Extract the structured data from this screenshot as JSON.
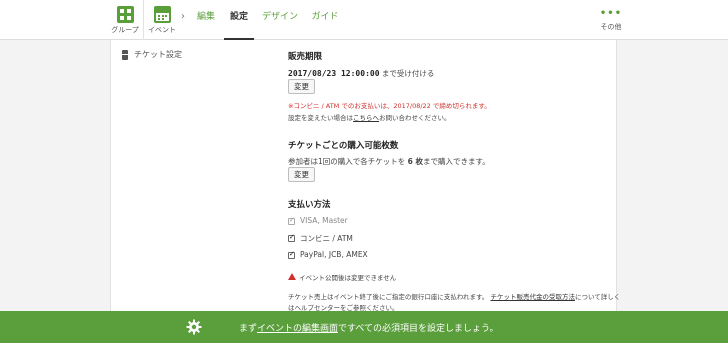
{
  "nav": {
    "group_label": "グループ",
    "event_label": "イベント",
    "chevron": "›",
    "tabs": [
      {
        "label": "編集",
        "active": false
      },
      {
        "label": "設定",
        "active": true
      },
      {
        "label": "デザイン",
        "active": false
      },
      {
        "label": "ガイド",
        "active": false
      }
    ],
    "more_dots": "•••",
    "more_label": "その他"
  },
  "sidebar": {
    "item_label": "チケット設定",
    "item_icon": "ticket-icon"
  },
  "sales_period": {
    "heading": "販売期限",
    "datetime": "2017/08/23 12:00:00",
    "datetime_suffix": " まで受け付ける",
    "change_button": "変更",
    "notice": "※コンビニ / ATM でのお支払いは、2017/08/22 で締め切られます。",
    "help_prefix": "設定を変えたい場合は",
    "help_link": "こちらへ",
    "help_suffix": "お問い合わせください。"
  },
  "purchase_limit": {
    "heading": "チケットごとの購入可能枚数",
    "text_prefix": "参加者は1回の購入で各チケットを ",
    "count": "6",
    "count_unit": " 枚",
    "text_suffix": "まで購入できます。",
    "change_button": "変更"
  },
  "payment": {
    "heading": "支払い方法",
    "methods": [
      {
        "label": "VISA, Master",
        "checked": true,
        "disabled": true
      },
      {
        "label": "コンビニ / ATM",
        "checked": true,
        "disabled": false
      },
      {
        "label": "PayPal, JCB, AMEX",
        "checked": true,
        "disabled": false
      }
    ],
    "warning": "イベント公開後は変更できません",
    "info_line1_prefix": "チケット売上はイベント終了後にご指定の銀行口座に支払われます。",
    "info_line1_link": "チケット販売代金の受取方法",
    "info_line1_suffix": "について詳しく",
    "info_line2": "はヘルプセンターをご参照ください。"
  },
  "bottom_bar": {
    "prefix": "まず",
    "link": "イベントの編集画面",
    "suffix": "ですべての必須項目を設定しましょう。",
    "icon": "gear-icon"
  },
  "colors": {
    "accent_green": "#5a9e3a",
    "bottom_bar": "#5b9e3c",
    "notice_red": "#d0312d"
  }
}
